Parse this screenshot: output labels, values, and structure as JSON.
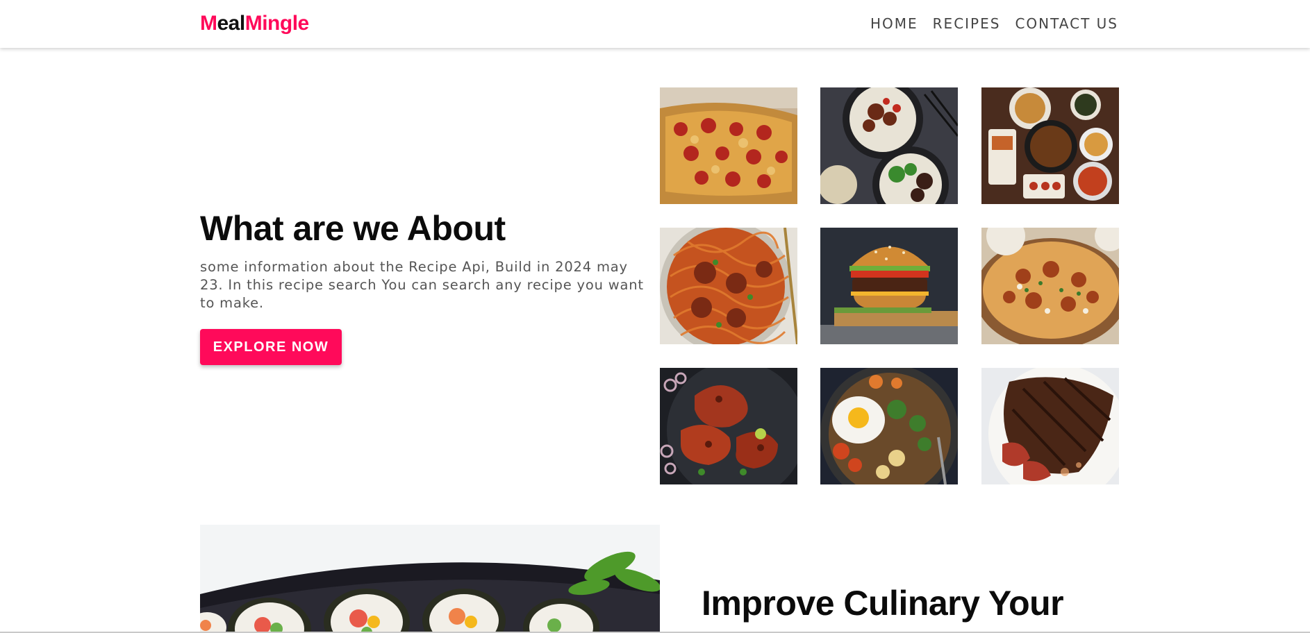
{
  "header": {
    "logo": {
      "part1": "M",
      "part2": "eal",
      "part3": "M",
      "part4": "ingle"
    },
    "nav": [
      "HOME",
      "RECIPES",
      "CONTACT US"
    ]
  },
  "hero": {
    "title": "What are we About",
    "text": "some information about the Recipe Api, Build in 2024 may 23. In this recipe search You can search any recipe you want to make.",
    "cta_label": "EXPLORE NOW"
  },
  "gallery": [
    {
      "icon": "pizza-image"
    },
    {
      "icon": "rice-bowls-image"
    },
    {
      "icon": "noodle-spread-image"
    },
    {
      "icon": "spaghetti-meatballs-image"
    },
    {
      "icon": "burger-image"
    },
    {
      "icon": "biryani-image"
    },
    {
      "icon": "tandoori-chicken-image"
    },
    {
      "icon": "bibimbap-image"
    },
    {
      "icon": "steak-image"
    }
  ],
  "section2": {
    "title": "Improve Culinary Your",
    "image": "sushi-image"
  },
  "colors": {
    "accent": "#ff0a5a",
    "text": "#111111",
    "muted": "#555555"
  }
}
